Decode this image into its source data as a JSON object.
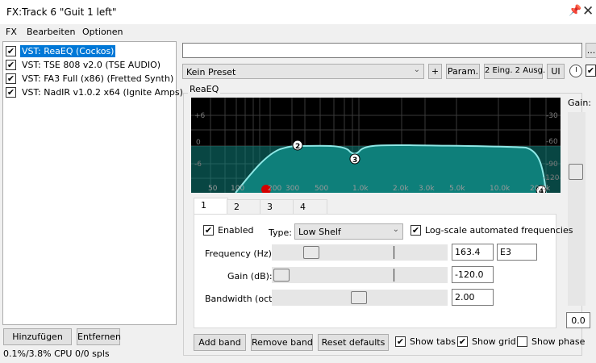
{
  "window": {
    "title": "FX:Track 6 \"Guit 1 left\""
  },
  "menu": [
    "FX",
    "Bearbeiten",
    "Optionen"
  ],
  "fx_list": [
    {
      "label": "VST: ReaEQ (Cockos)",
      "checked": true,
      "selected": true
    },
    {
      "label": "VST: TSE 808 v2.0 (TSE AUDIO)",
      "checked": true
    },
    {
      "label": "VST: FA3 Full (x86) (Fretted Synth)",
      "checked": true
    },
    {
      "label": "VST: NadIR v1.0.2 x64 (Ignite Amps)",
      "checked": true
    }
  ],
  "buttons": {
    "add": "Hinzufügen",
    "remove": "Entfernen",
    "ellipsis": "...",
    "plus": "+",
    "param": "Param.",
    "io": "2 Eing. 2 Ausg.",
    "ui": "UI"
  },
  "status": "0.1%/3.8% CPU 0/0 spls",
  "preset": {
    "value": "Kein Preset"
  },
  "plugin": {
    "title": "ReaEQ"
  },
  "graph": {
    "db_labels": [
      "+6",
      "0",
      "-6"
    ],
    "right_labels": [
      "-30",
      "-60",
      "-90",
      "-120"
    ],
    "freq_labels": [
      "50",
      "100",
      "200",
      "300",
      "500",
      "1.0k",
      "2.0k",
      "3.0k",
      "5.0k",
      "10.0k",
      "20.0k"
    ],
    "points": [
      "2",
      "3",
      "4"
    ],
    "colors": {
      "background": "#000000",
      "fill": "#0e7f7a",
      "curve": "#8fe8e6",
      "grid": "#3a3a3a",
      "marker_red": "#d40000"
    }
  },
  "tabs": [
    "1",
    "2",
    "3",
    "4"
  ],
  "band": {
    "enabled_label": "Enabled",
    "enabled": true,
    "type_label": "Type:",
    "type_value": "Low Shelf",
    "logscale_label": "Log-scale automated frequencies",
    "logscale": true,
    "freq_label": "Frequency (Hz):",
    "freq_value": "163.4",
    "note_value": "E3",
    "gain_label": "Gain (dB):",
    "gain_value": "-120.0",
    "bw_label": "Bandwidth (oct):",
    "bw_value": "2.00"
  },
  "bottom": {
    "add_band": "Add band",
    "remove_band": "Remove band",
    "reset": "Reset defaults",
    "show_tabs": "Show tabs",
    "show_grid": "Show grid",
    "show_phase": "Show phase",
    "show_tabs_checked": true,
    "show_grid_checked": true,
    "show_phase_checked": false
  },
  "gain": {
    "label": "Gain:",
    "value": "0.0"
  }
}
